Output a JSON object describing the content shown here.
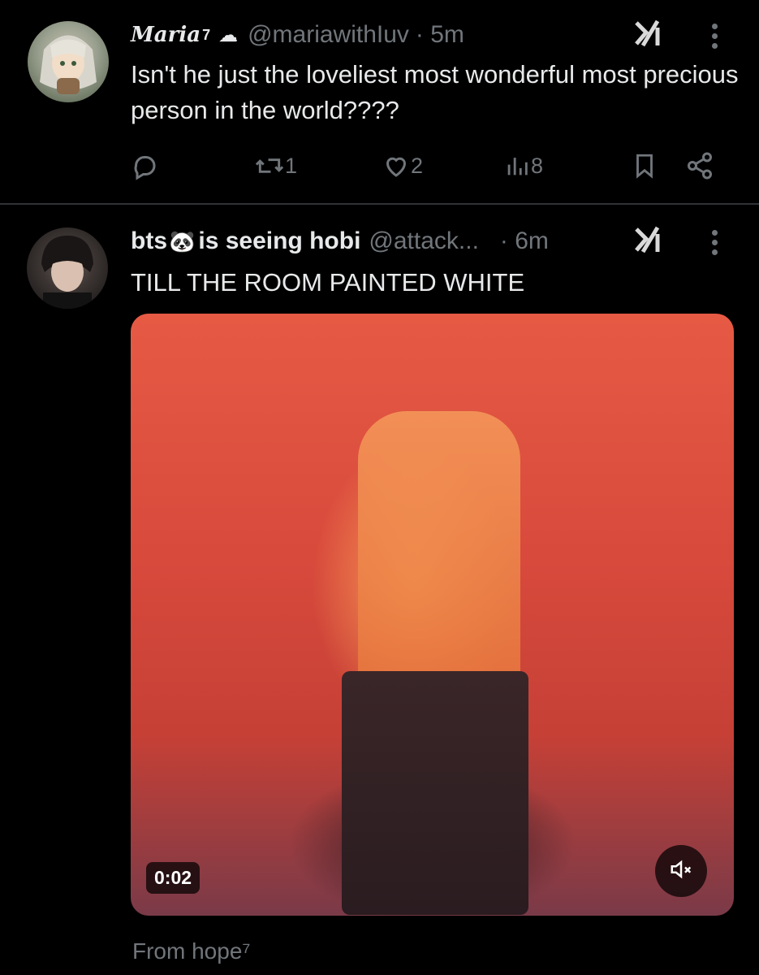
{
  "tweets": [
    {
      "display_name": "Maria",
      "display_name_suffix": "7",
      "name_emoji": "☁",
      "handle": "@mariawithIuv",
      "time": "· 5m",
      "text": "Isn't he just the loveliest most wonderful most precious person in the world????",
      "actions": {
        "retweets": "1",
        "likes": "2",
        "views": "8"
      }
    },
    {
      "display_name": "bts",
      "name_emoji": "🐼",
      "display_name_rest": "is seeing hobi",
      "handle": "@attack...",
      "time": "· 6m",
      "text": "TILL THE ROOM PAINTED WHITE",
      "media": {
        "type": "video",
        "timestamp": "0:02"
      },
      "source_label": "From hope⁷"
    }
  ],
  "icons": {
    "grok": "grok-icon",
    "more": "more-options-icon",
    "reply": "reply-icon",
    "retweet": "retweet-icon",
    "like": "heart-icon",
    "views": "views-icon",
    "bookmark": "bookmark-icon",
    "share": "share-icon",
    "mute": "mute-icon"
  },
  "colors": {
    "background": "#000000",
    "text": "#e7e9ea",
    "secondary": "#71767b",
    "divider": "#2f3336"
  }
}
